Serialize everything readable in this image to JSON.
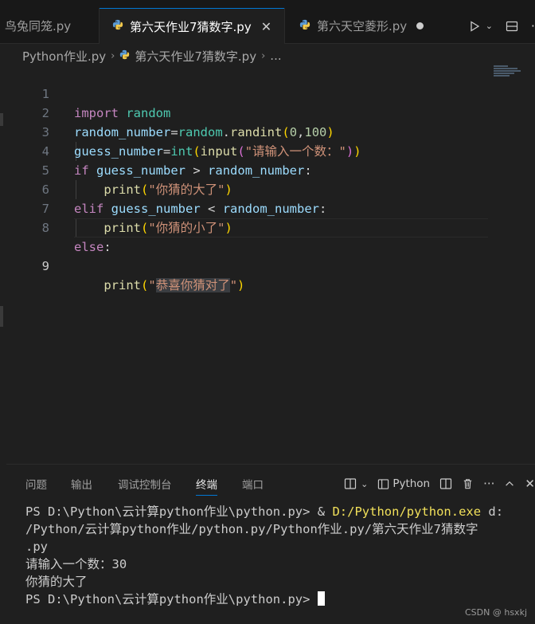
{
  "tabs": [
    {
      "label": "鸟兔同笼.py",
      "active": false
    },
    {
      "label": "第六天作业7猜数字.py",
      "active": true
    },
    {
      "label": "第六天空菱形.py",
      "active": false,
      "unsaved": true
    }
  ],
  "breadcrumb": {
    "folder": "Python作业.py",
    "file": "第六天作业7猜数字.py",
    "more": "..."
  },
  "editor": {
    "current_line": 9,
    "lines": [
      "import random",
      "random_number=random.randint(0,100)",
      "guess_number=int(input(\"请输入一个数：\"))",
      "if guess_number > random_number:",
      "    print(\"你猜的大了\")",
      "elif guess_number < random_number:",
      "    print(\"你猜的小了\")",
      "else:",
      "    print(\"恭喜你猜对了\")"
    ]
  },
  "panel": {
    "tabs": [
      "问题",
      "输出",
      "调试控制台",
      "终端",
      "端口"
    ],
    "active_tab": "终端",
    "terminal_profile": "Python",
    "terminal_lines": [
      {
        "prompt": "PS D:\\Python\\云计算python作业\\python.py> & ",
        "exe": "D:/Python/python.exe",
        "rest": " d:"
      },
      {
        "text": "/Python/云计算python作业/python.py/Python作业.py/第六天作业7猜数字"
      },
      {
        "text": ".py"
      },
      {
        "text": "请输入一个数：30"
      },
      {
        "text": "你猜的大了"
      },
      {
        "prompt_only": "PS D:\\Python\\云计算python作业\\python.py> "
      }
    ]
  },
  "watermark": "CSDN @ hsxkj",
  "icons": {
    "python": "python-file-icon",
    "close": "close-icon",
    "run": "run-icon",
    "split": "split-editor-icon"
  }
}
